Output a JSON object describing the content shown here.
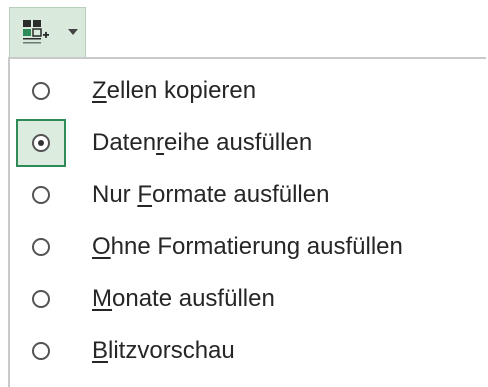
{
  "trigger": {
    "icon": "autofill-options-icon",
    "chevron": "chevron-down-icon",
    "colors": {
      "background": "#d9eadd",
      "icon_green": "#2e8b57",
      "icon_dark": "#2b2b2b"
    }
  },
  "menu": {
    "selected_index": 1,
    "selected_color": "#2e8b57",
    "items": [
      {
        "label": "Zellen kopieren",
        "accel_before": "",
        "accel": "Z",
        "accel_after": "ellen kopieren",
        "selected": false
      },
      {
        "label": "Datenreihe ausfüllen",
        "accel_before": "Daten",
        "accel": "r",
        "accel_after": "eihe ausfüllen",
        "selected": true
      },
      {
        "label": "Nur Formate ausfüllen",
        "accel_before": "Nur ",
        "accel": "F",
        "accel_after": "ormate ausfüllen",
        "selected": false
      },
      {
        "label": "Ohne Formatierung ausfüllen",
        "accel_before": "",
        "accel": "O",
        "accel_after": "hne Formatierung ausfüllen",
        "selected": false
      },
      {
        "label": "Monate ausfüllen",
        "accel_before": "",
        "accel": "M",
        "accel_after": "onate ausfüllen",
        "selected": false
      },
      {
        "label": "Blitzvorschau",
        "accel_before": "",
        "accel": "B",
        "accel_after": "litzvorschau",
        "selected": false
      }
    ]
  }
}
